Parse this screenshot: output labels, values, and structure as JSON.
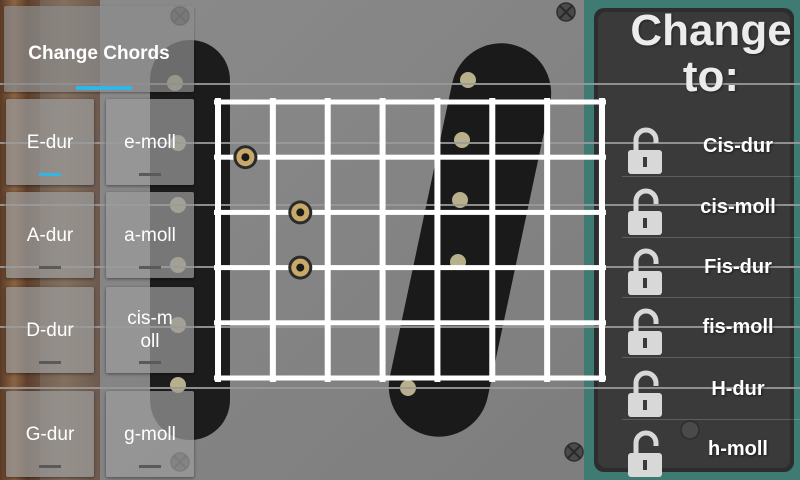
{
  "left_panel": {
    "header_button": {
      "label": "Change Chords"
    },
    "chords": [
      {
        "label": "E-dur",
        "active": true
      },
      {
        "label": "e-moll",
        "active": false
      },
      {
        "label": "A-dur",
        "active": false
      },
      {
        "label": "a-moll",
        "active": false
      },
      {
        "label": "D-dur",
        "active": false
      },
      {
        "label": "cis-moll",
        "active": false
      },
      {
        "label": "G-dur",
        "active": false
      },
      {
        "label": "g-moll",
        "active": false
      }
    ]
  },
  "fretboard": {
    "strings": 6,
    "frets": 5,
    "finger_positions": [
      {
        "string": 1,
        "fret": 2
      },
      {
        "string": 2,
        "fret": 3
      },
      {
        "string": 2,
        "fret": 4
      }
    ]
  },
  "right_panel": {
    "title": "Change to:",
    "targets": [
      {
        "label": "Cis-dur",
        "icon": "unlocked-padlock-icon"
      },
      {
        "label": "cis-moll",
        "icon": "unlocked-padlock-icon"
      },
      {
        "label": "Fis-dur",
        "icon": "unlocked-padlock-icon"
      },
      {
        "label": "fis-moll",
        "icon": "unlocked-padlock-icon"
      },
      {
        "label": "H-dur",
        "icon": "unlocked-padlock-icon"
      },
      {
        "label": "h-moll",
        "icon": "unlocked-padlock-icon"
      }
    ]
  },
  "colors": {
    "accent": "#33b5e5",
    "guitar_body": "#6d6d6d",
    "pickguard": "#8a8a8a",
    "pickup": "#1a1a1a",
    "teal_plate": "#3d7a70",
    "fret_line": "#ffffff",
    "finger_marker": "#c8a96a"
  }
}
